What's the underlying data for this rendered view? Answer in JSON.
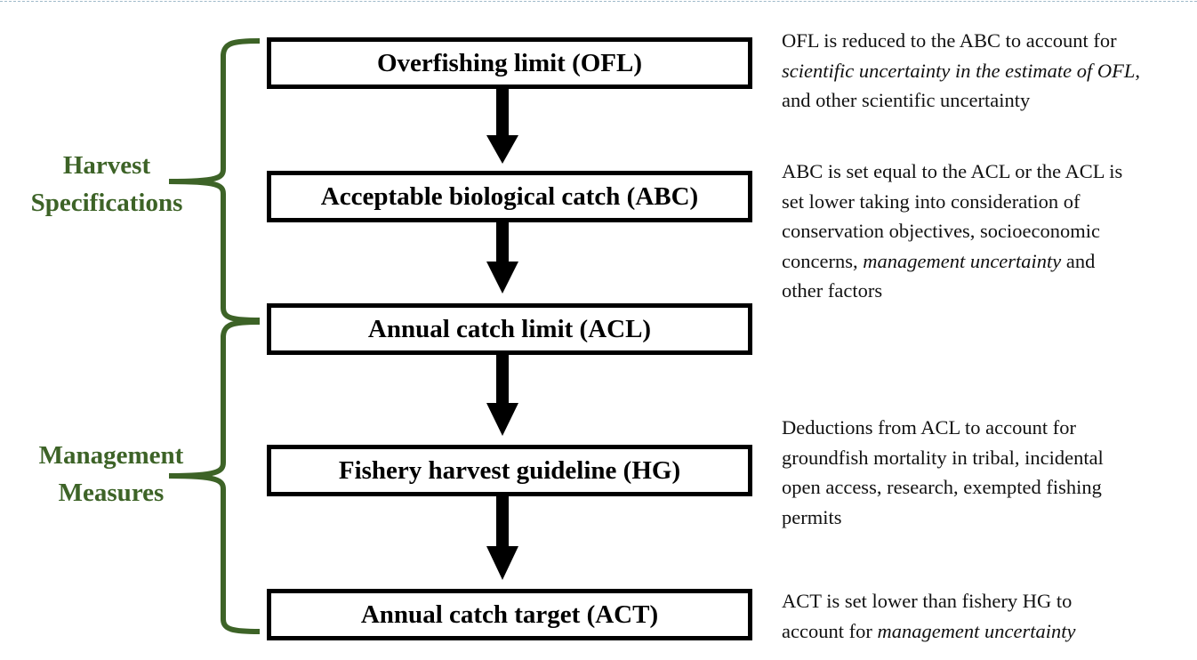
{
  "colors": {
    "brace": "#3d6327",
    "box_border": "#000000",
    "arrow": "#000000"
  },
  "boxes": [
    {
      "label": "Overfishing limit (OFL)"
    },
    {
      "label": "Acceptable biological catch (ABC)"
    },
    {
      "label": "Annual catch limit (ACL)"
    },
    {
      "label": "Fishery harvest guideline (HG)"
    },
    {
      "label": "Annual catch target (ACT)"
    }
  ],
  "groups": [
    {
      "lines": [
        "Harvest",
        "Specifications"
      ]
    },
    {
      "lines": [
        "Management",
        "Measures"
      ]
    }
  ],
  "descriptions": [
    {
      "lines": [
        [
          {
            "text": "OFL is reduced to the ABC to account for",
            "italic": false
          }
        ],
        [
          {
            "text": "scientific uncertainty in the estimate of OFL",
            "italic": true
          },
          {
            "text": ",",
            "italic": false
          }
        ],
        [
          {
            "text": "and other scientific uncertainty",
            "italic": false
          }
        ]
      ]
    },
    {
      "lines": [
        [
          {
            "text": "ABC is set equal to the ACL or the ACL is",
            "italic": false
          }
        ],
        [
          {
            "text": "set lower taking into consideration of",
            "italic": false
          }
        ],
        [
          {
            "text": "conservation objectives, socioeconomic",
            "italic": false
          }
        ],
        [
          {
            "text": "concerns, ",
            "italic": false
          },
          {
            "text": "management uncertainty",
            "italic": true
          },
          {
            "text": " and",
            "italic": false
          }
        ],
        [
          {
            "text": "other factors",
            "italic": false
          }
        ]
      ]
    },
    {
      "lines": [
        [
          {
            "text": "Deductions from ACL to account for",
            "italic": false
          }
        ],
        [
          {
            "text": "groundfish mortality in tribal, incidental",
            "italic": false
          }
        ],
        [
          {
            "text": "open access, research, exempted fishing",
            "italic": false
          }
        ],
        [
          {
            "text": "permits",
            "italic": false
          }
        ]
      ]
    },
    {
      "lines": [
        [
          {
            "text": "ACT is set lower than fishery HG to",
            "italic": false
          }
        ],
        [
          {
            "text": "account for ",
            "italic": false
          },
          {
            "text": "management uncertainty",
            "italic": true
          }
        ]
      ]
    }
  ]
}
